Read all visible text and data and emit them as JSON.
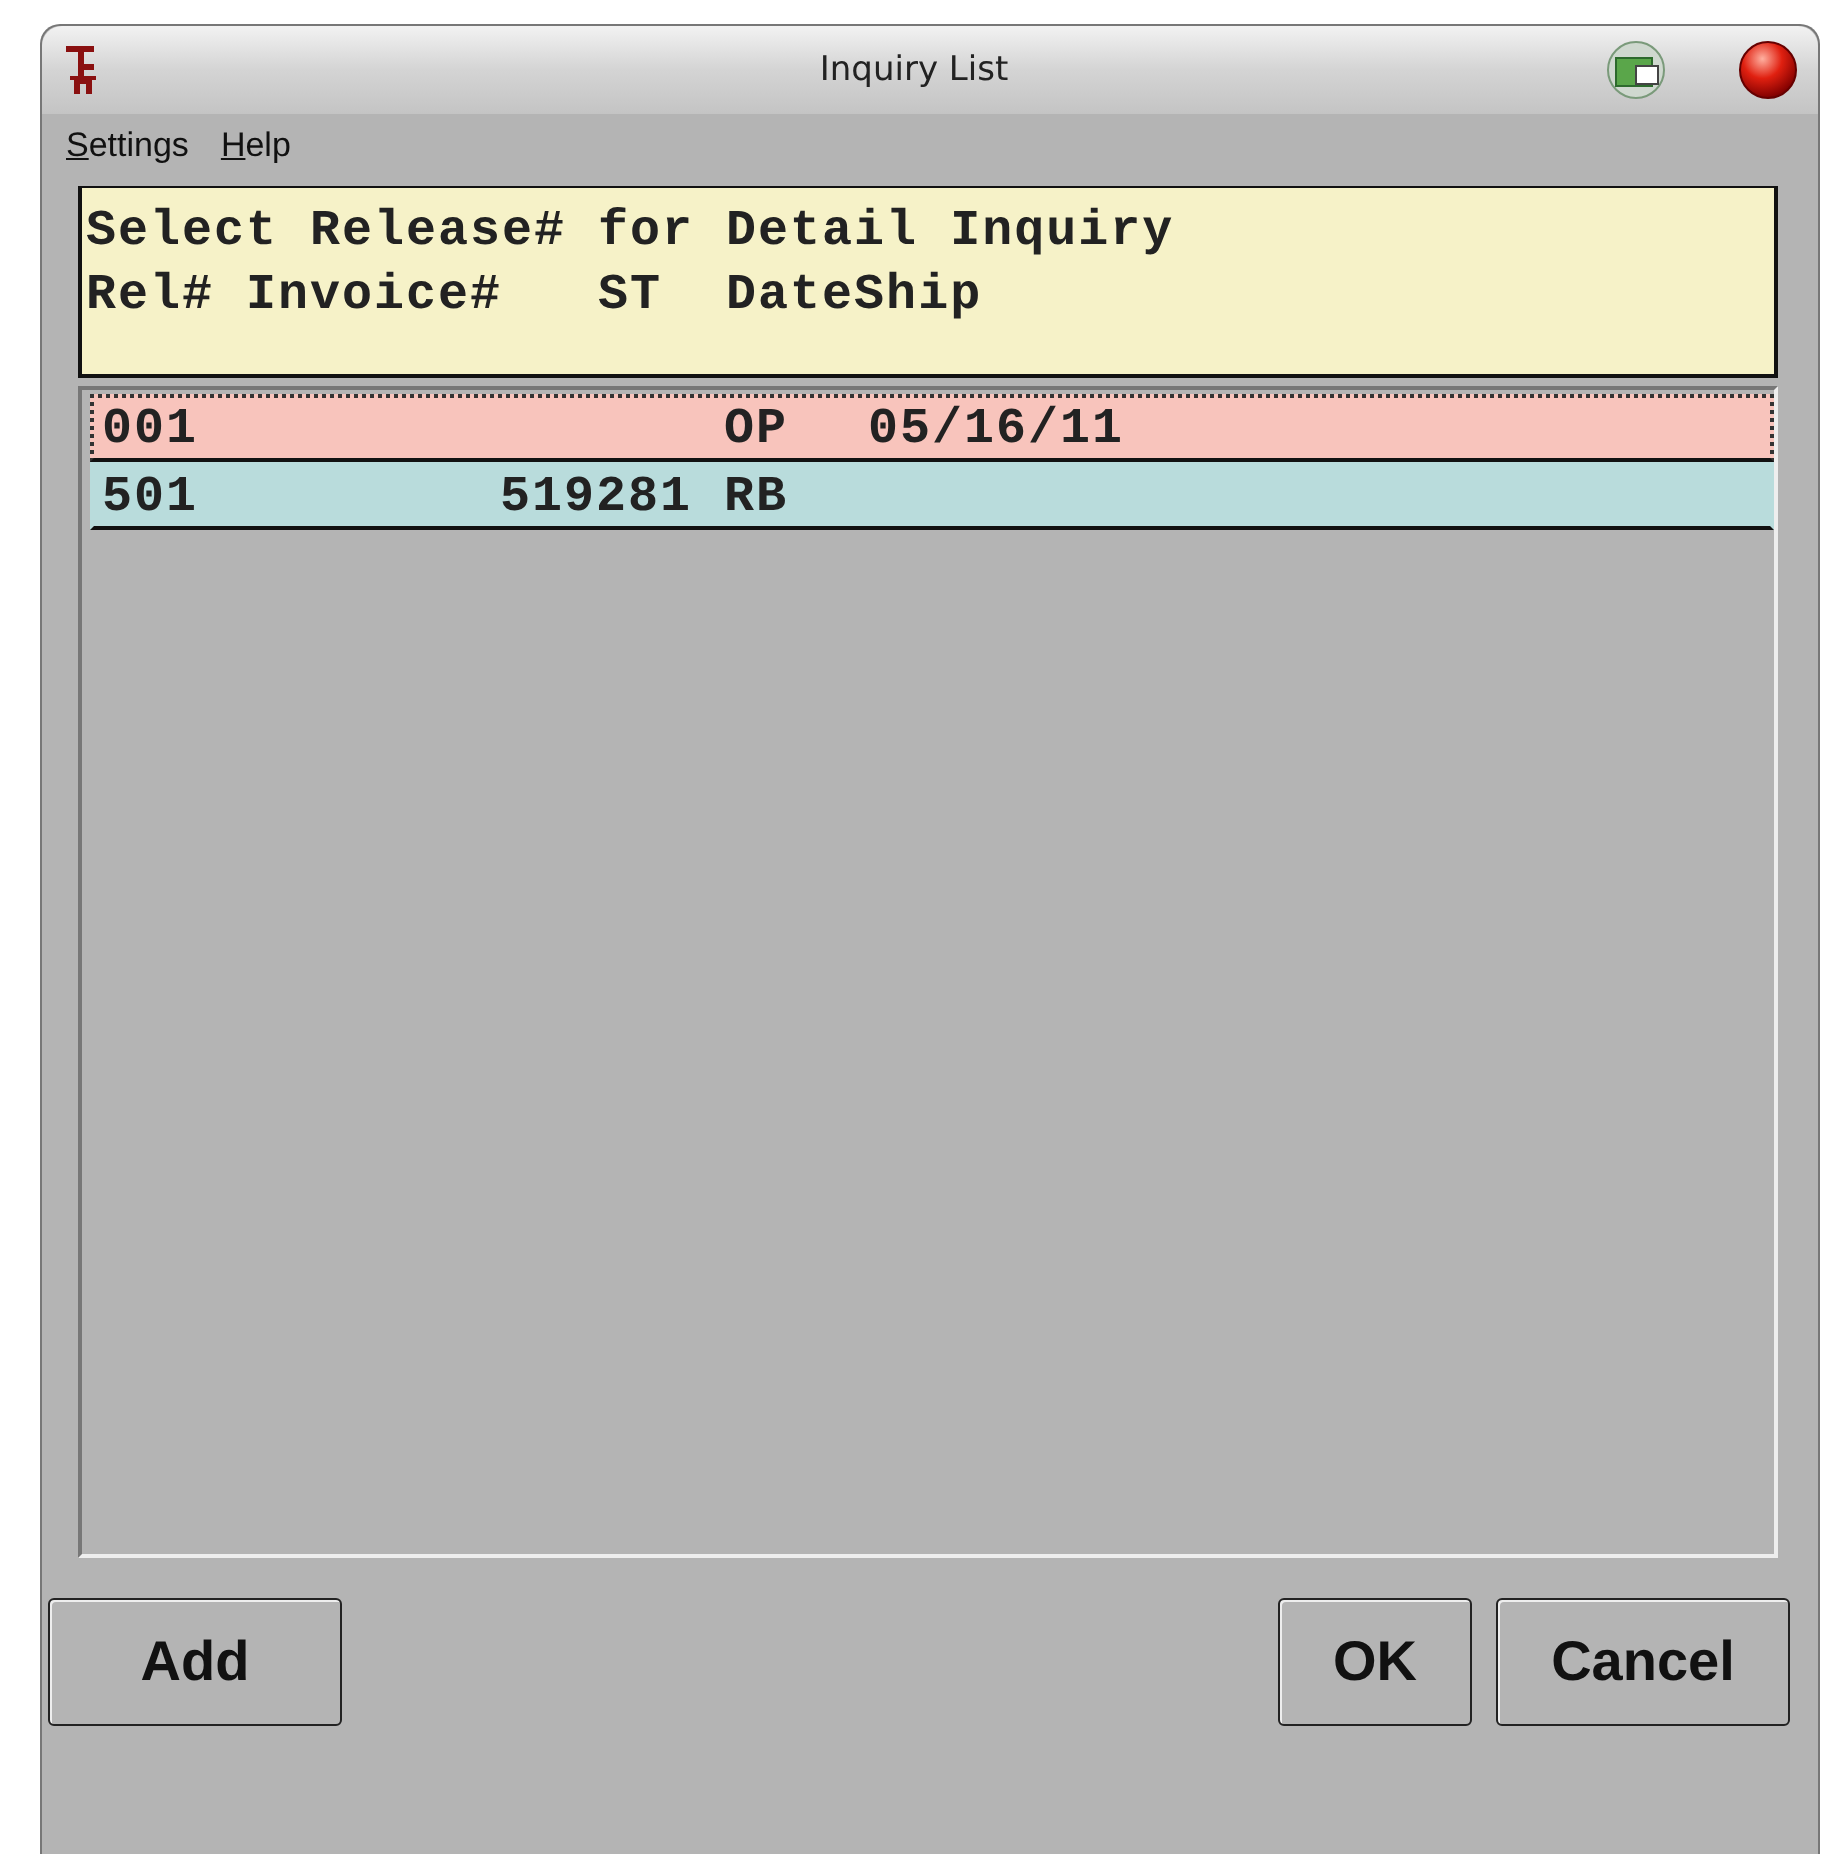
{
  "window": {
    "title": "Inquiry List"
  },
  "menu": [
    {
      "label": "Settings"
    },
    {
      "label": "Help"
    }
  ],
  "heading_lines": [
    "Select Release# for Detail Inquiry",
    "Rel# Invoice#   ST  DateShip"
  ],
  "rows": [
    {
      "rel": "001",
      "invoice": "",
      "st": "OP",
      "date": "05/16/11",
      "color": "#f8c4bc",
      "selected": true
    },
    {
      "rel": "501",
      "invoice": "519281",
      "st": "RB",
      "date": "",
      "color": "#b9dcdc",
      "selected": false
    }
  ],
  "buttons_left": [
    "Add"
  ],
  "buttons_right": [
    "OK",
    "Cancel"
  ]
}
